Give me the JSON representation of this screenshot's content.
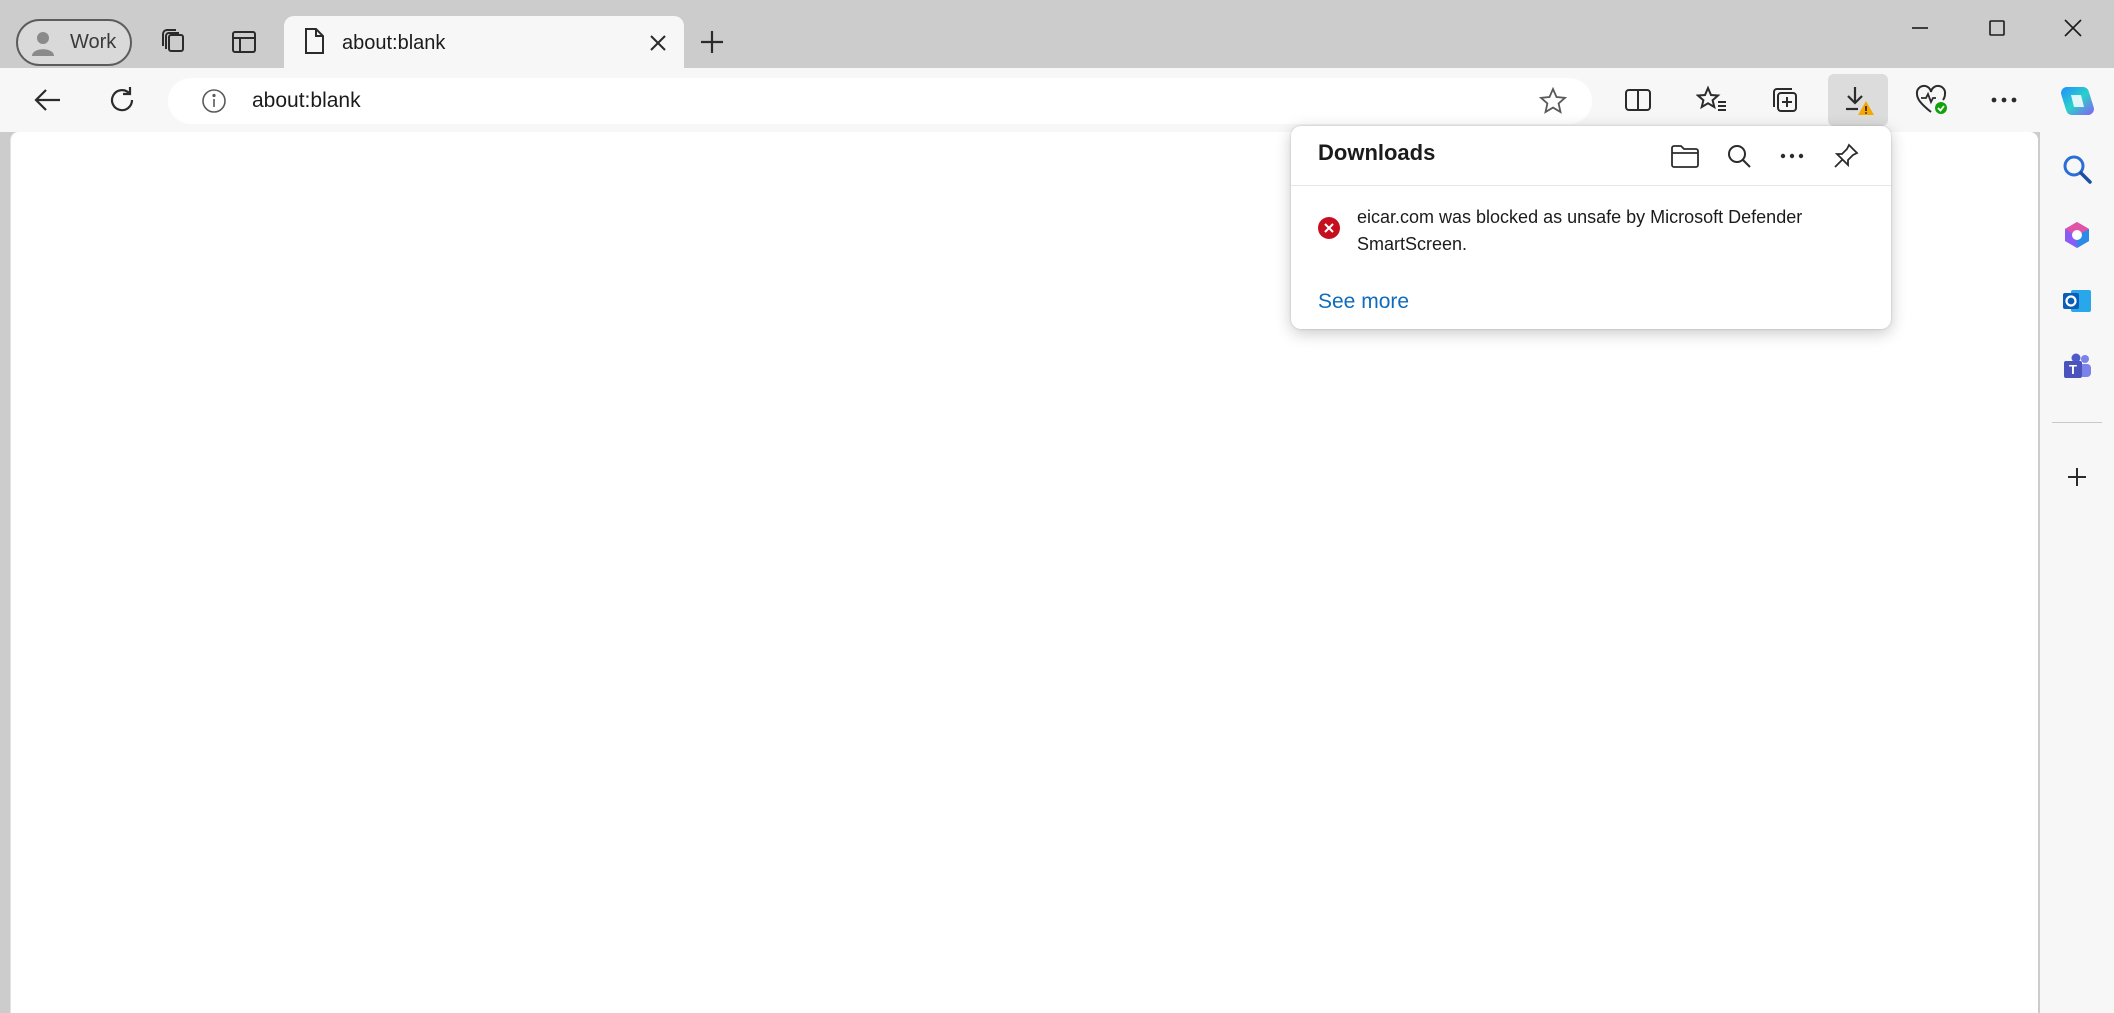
{
  "profile": {
    "label": "Work"
  },
  "tab": {
    "title": "about:blank",
    "close_icon": "close-icon"
  },
  "toolbar": {
    "url": "about:blank",
    "icons": [
      "back-icon",
      "refresh-icon",
      "split-screen-icon",
      "favorites-icon",
      "collections-icon",
      "downloads-warning-icon",
      "browser-essentials-icon",
      "more-icon"
    ]
  },
  "downloads": {
    "title": "Downloads",
    "items": [
      {
        "message": "eicar.com was blocked as unsafe by Microsoft Defender SmartScreen.",
        "status": "blocked"
      }
    ],
    "see_more": "See more"
  },
  "sidebar": {
    "icons": [
      "copilot-icon",
      "search-icon",
      "m365-icon",
      "outlook-icon",
      "teams-icon",
      "add-icon"
    ]
  },
  "colors": {
    "chrome": "#cccccc",
    "toolbar": "#f7f7f7",
    "link": "#0f6cbd",
    "error": "#c50f1f",
    "warning": "#f7a800"
  }
}
